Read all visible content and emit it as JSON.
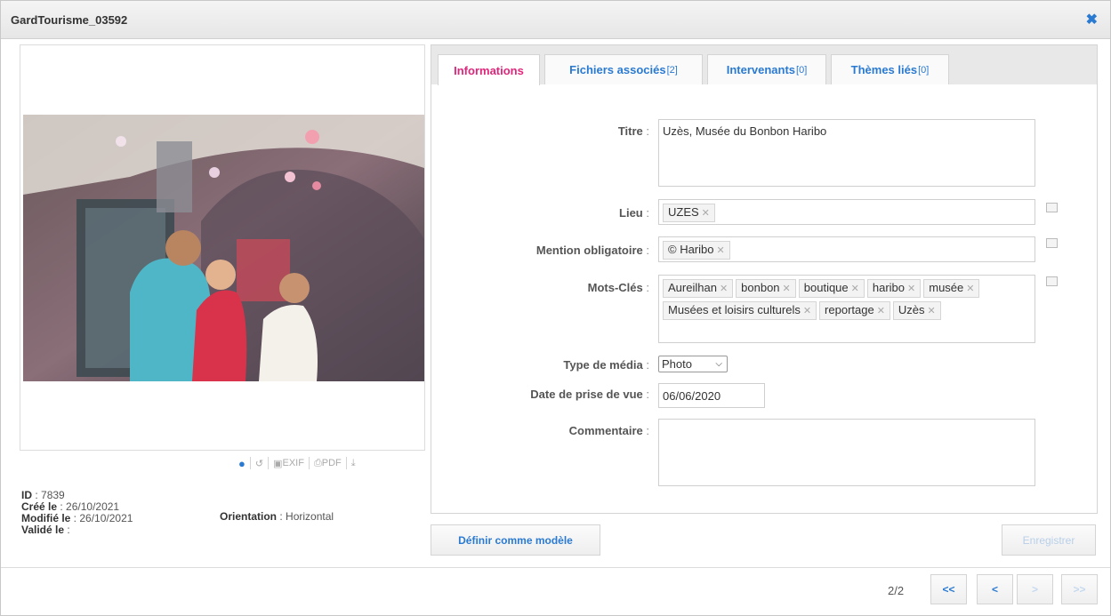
{
  "window": {
    "title": "GardTourisme_03592",
    "close_icon": "close-icon"
  },
  "preview": {
    "toolbar": [
      {
        "icon": "map-pin-icon",
        "label": ""
      },
      {
        "icon": "history-icon",
        "label": ""
      },
      {
        "icon": "camera-icon",
        "label": "EXIF"
      },
      {
        "icon": "printer-icon",
        "label": "PDF"
      },
      {
        "icon": "download-icon",
        "label": ""
      }
    ]
  },
  "meta": {
    "id_label": "ID",
    "id_value": "7839",
    "created_label": "Créé le",
    "created_value": "26/10/2021",
    "modified_label": "Modifié le",
    "modified_value": "26/10/2021",
    "validated_label": "Validé le",
    "validated_value": "",
    "orientation_label": "Orientation",
    "orientation_value": "Horizontal"
  },
  "tabs": [
    {
      "label": "Informations",
      "count": "",
      "active": true
    },
    {
      "label": "Fichiers associés",
      "count": "[2]",
      "active": false
    },
    {
      "label": "Intervenants",
      "count": "[0]",
      "active": false
    },
    {
      "label": "Thèmes liés",
      "count": "[0]",
      "active": false
    }
  ],
  "form": {
    "titre_label": "Titre",
    "titre_value": "Uzès, Musée du Bonbon Haribo",
    "lieu_label": "Lieu",
    "lieu_tags": [
      "UZES"
    ],
    "mention_label": "Mention obligatoire",
    "mention_tags": [
      "© Haribo"
    ],
    "mots_label": "Mots-Clés",
    "mots_tags": [
      "Aureilhan",
      "bonbon",
      "boutique",
      "haribo",
      "musée",
      "Musées et loisirs culturels",
      "reportage",
      "Uzès"
    ],
    "type_label": "Type de média",
    "type_value": "Photo",
    "date_label": "Date de prise de vue",
    "date_value": "06/06/2020",
    "commentaire_label": "Commentaire",
    "commentaire_value": ""
  },
  "actions": {
    "template_button": "Définir comme modèle",
    "save_button": "Enregistrer"
  },
  "pager": {
    "text": "2/2",
    "first": "<<",
    "prev": "<",
    "next": ">",
    "last": ">>"
  },
  "colors": {
    "accent": "#2a7ad2",
    "active_tab": "#e0267a"
  }
}
